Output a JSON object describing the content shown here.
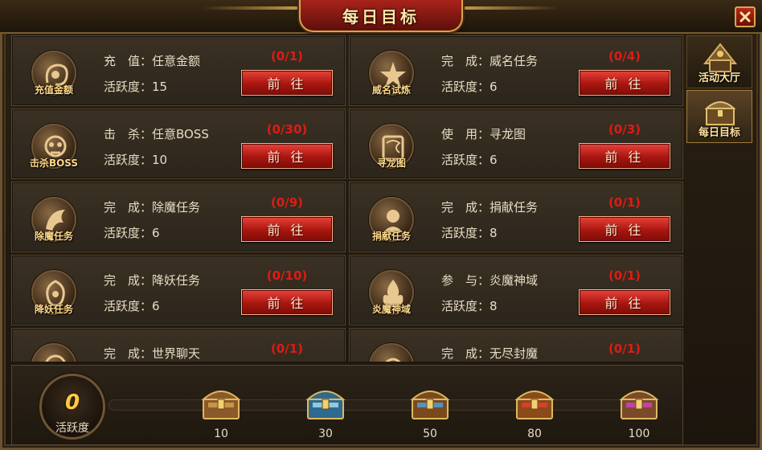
{
  "window": {
    "title": "每日目标",
    "close_glyph": "✕"
  },
  "action_label": "前 往",
  "tasks": [
    {
      "icon": "recharge-icon",
      "icon_label": "充值金额",
      "line1": "充　值：任意金额",
      "activity": "活跃度：15",
      "progress": "(0/1)"
    },
    {
      "icon": "prestige-icon",
      "icon_label": "威名试炼",
      "line1": "完　成：威名任务",
      "activity": "活跃度：6",
      "progress": "(0/4)"
    },
    {
      "icon": "kill-boss-icon",
      "icon_label": "击杀BOSS",
      "line1": "击　杀：任意BOSS",
      "activity": "活跃度：10",
      "progress": "(0/30)"
    },
    {
      "icon": "dragon-map-icon",
      "icon_label": "寻龙图",
      "line1": "使　用：寻龙图",
      "activity": "活跃度：6",
      "progress": "(0/3)"
    },
    {
      "icon": "demon-quest-icon",
      "icon_label": "除魔任务",
      "line1": "完　成：除魔任务",
      "activity": "活跃度：6",
      "progress": "(0/9)"
    },
    {
      "icon": "donate-icon",
      "icon_label": "捐献任务",
      "line1": "完　成：捐献任务",
      "activity": "活跃度：8",
      "progress": "(0/1)"
    },
    {
      "icon": "subdue-monster-icon",
      "icon_label": "降妖任务",
      "line1": "完　成：降妖任务",
      "activity": "活跃度：6",
      "progress": "(0/10)"
    },
    {
      "icon": "flame-domain-icon",
      "icon_label": "炎魔神域",
      "line1": "参　与：炎魔神域",
      "activity": "活跃度：8",
      "progress": "(0/1)"
    },
    {
      "icon": "world-chat-icon",
      "icon_label": "",
      "line1": "完　成：世界聊天",
      "activity": "",
      "progress": "(0/1)"
    },
    {
      "icon": "endless-seal-icon",
      "icon_label": "",
      "line1": "完　成：无尽封魔",
      "activity": "",
      "progress": "(0/1)"
    }
  ],
  "side_tabs": [
    {
      "label": "活动大厅",
      "icon": "activity-hall-icon",
      "active": false
    },
    {
      "label": "每日目标",
      "icon": "daily-goal-chest-icon",
      "active": true
    }
  ],
  "activity_score": {
    "value": "0",
    "label": "活跃度",
    "progress_fraction": 0
  },
  "reward_chests": [
    {
      "threshold": "10",
      "color": "#8a5a2a",
      "accent": "#d0a050"
    },
    {
      "threshold": "30",
      "color": "#2e6a8e",
      "accent": "#9fd8f0"
    },
    {
      "threshold": "50",
      "color": "#7a4a1e",
      "accent": "#4aa0e0"
    },
    {
      "threshold": "80",
      "color": "#8a4a1a",
      "accent": "#e04030"
    },
    {
      "threshold": "100",
      "color": "#7a4a2a",
      "accent": "#d040c0"
    }
  ]
}
